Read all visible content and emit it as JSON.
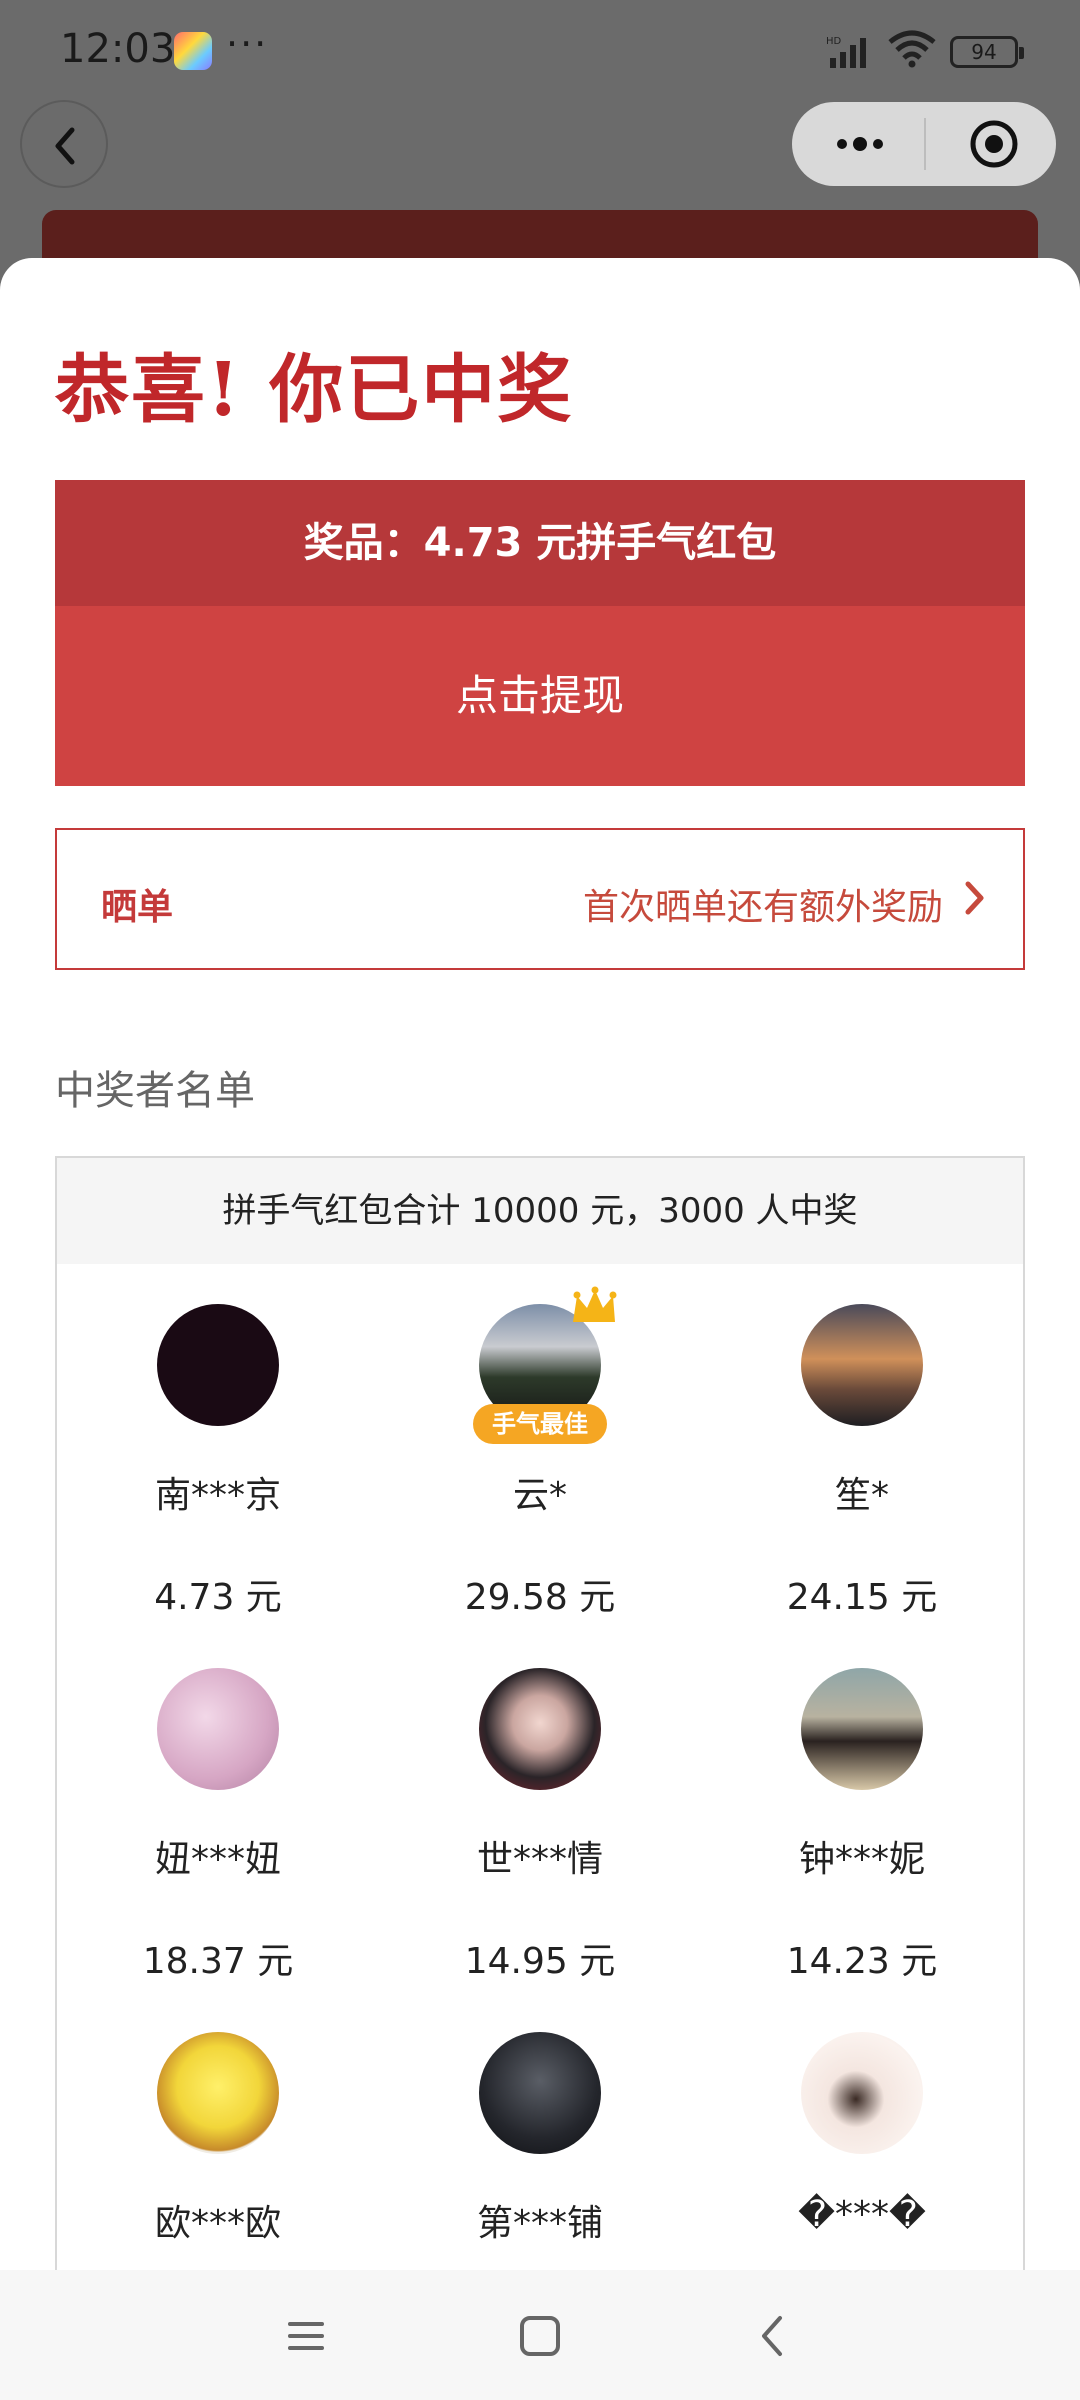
{
  "status_bar": {
    "time": "12:03",
    "more": "···",
    "battery": "94"
  },
  "header": {
    "headline": "恭喜! 你已中奖"
  },
  "prize": {
    "title": "奖品：4.73 元拼手气红包",
    "withdraw_label": "点击提现"
  },
  "share": {
    "label": "晒单",
    "tip": "首次晒单还有额外奖励"
  },
  "winners": {
    "title": "中奖者名单",
    "summary": "拼手气红包合计 10000 元，3000 人中奖",
    "best_badge": "手气最佳",
    "items": [
      {
        "name": "南***京",
        "amount": "4.73 元",
        "avatar": "dark-avatar"
      },
      {
        "name": "云*",
        "amount": "29.58 元",
        "avatar": "landscape-avatar"
      },
      {
        "name": "笙*",
        "amount": "24.15 元",
        "avatar": "sunset-avatar"
      },
      {
        "name": "妞***妞",
        "amount": "18.37 元",
        "avatar": "pink-avatar"
      },
      {
        "name": "世***情",
        "amount": "14.95 元",
        "avatar": "anime-avatar"
      },
      {
        "name": "钟***妮",
        "amount": "14.23 元",
        "avatar": "beach-avatar"
      },
      {
        "name": "欧***欧",
        "amount": "",
        "avatar": "spongebob-avatar"
      },
      {
        "name": "第***铺",
        "amount": "",
        "avatar": "poster-avatar"
      },
      {
        "name": "�***�",
        "amount": "",
        "avatar": "cartoon-girl-avatar"
      }
    ]
  },
  "colors": {
    "accent_red": "#c0272a",
    "prize_title_bg": "#b6383a",
    "withdraw_bg": "#cf4342",
    "badge_gold": "#f5a623"
  }
}
